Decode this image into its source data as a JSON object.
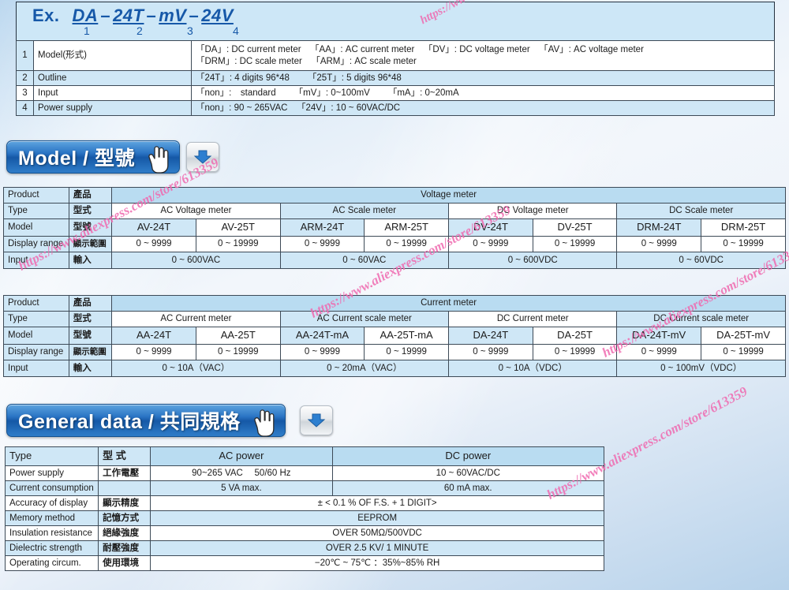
{
  "example": {
    "label": "Ex.",
    "parts": [
      "DA",
      "24T",
      "mV",
      "24V"
    ],
    "separator": "–",
    "numbers": [
      "1",
      "2",
      "3",
      "4"
    ]
  },
  "code_table": {
    "rows": [
      {
        "no": "1",
        "item": "Model(形式)",
        "desc_line1": "「DA」: DC current meter 「AA」: AC current meter 「DV」: DC voltage meter 「AV」: AC voltage meter",
        "desc_line2": "「DRM」: DC scale meter 「ARM」: AC scale meter"
      },
      {
        "no": "2",
        "item": "Outline",
        "desc_line1": "「24T」: 4 digits 96*48  「25T」: 5 digits 96*48",
        "desc_line2": ""
      },
      {
        "no": "3",
        "item": "Input",
        "desc_line1": "「non」: standard  「mV」: 0~100mV  「mA」: 0~20mA",
        "desc_line2": ""
      },
      {
        "no": "4",
        "item": "Power supply",
        "desc_line1": "「non」: 90 ~ 265VAC 「24V」: 10 ~ 60VAC/DC",
        "desc_line2": ""
      }
    ]
  },
  "model_section": {
    "banner_label": "Model / 型號",
    "icons": {
      "hand": "hand-pointer-icon",
      "arrow": "chevron-down-icon"
    },
    "voltage_table": {
      "row_labels": [
        {
          "en": "Product",
          "zh": "產品"
        },
        {
          "en": "Type",
          "zh": "型式"
        },
        {
          "en": "Model",
          "zh": "型號"
        },
        {
          "en": "Display range",
          "zh": "顯示範圍"
        },
        {
          "en": "Input",
          "zh": "輸入"
        }
      ],
      "product": "Voltage meter",
      "types": [
        "AC Voltage meter",
        "AC Scale meter",
        "DC Voltage meter",
        "DC Scale meter"
      ],
      "models": [
        "AV-24T",
        "AV-25T",
        "ARM-24T",
        "ARM-25T",
        "DV-24T",
        "DV-25T",
        "DRM-24T",
        "DRM-25T"
      ],
      "display_ranges": [
        "0 ~ 9999",
        "0 ~ 19999",
        "0 ~ 9999",
        "0 ~ 19999",
        "0 ~ 9999",
        "0 ~ 19999",
        "0 ~ 9999",
        "0 ~ 19999"
      ],
      "inputs": [
        "0 ~ 600VAC",
        "0 ~ 60VAC",
        "0 ~ 600VDC",
        "0 ~ 60VDC"
      ]
    },
    "current_table": {
      "row_labels": [
        {
          "en": "Product",
          "zh": "產品"
        },
        {
          "en": "Type",
          "zh": "型式"
        },
        {
          "en": "Model",
          "zh": "型號"
        },
        {
          "en": "Display range",
          "zh": "顯示範圍"
        },
        {
          "en": "Input",
          "zh": "輸入"
        }
      ],
      "product": "Current meter",
      "types": [
        "AC Current meter",
        "AC Current scale meter",
        "DC Current meter",
        "DC Current scale meter"
      ],
      "models": [
        "AA-24T",
        "AA-25T",
        "AA-24T-mA",
        "AA-25T-mA",
        "DA-24T",
        "DA-25T",
        "DA-24T-mV",
        "DA-25T-mV"
      ],
      "display_ranges": [
        "0 ~ 9999",
        "0 ~ 19999",
        "0 ~ 9999",
        "0 ~ 19999",
        "0 ~ 9999",
        "0 ~ 19999",
        "0 ~ 9999",
        "0 ~ 19999"
      ],
      "inputs": [
        "0 ~ 10A（VAC）",
        "0 ~ 20mA（VAC）",
        "0 ~ 10A（VDC）",
        "0 ~ 100mV（VDC）"
      ]
    }
  },
  "general_section": {
    "banner_label": "General data / 共同規格",
    "icons": {
      "hand": "hand-pointer-icon",
      "arrow": "chevron-down-icon"
    },
    "table": {
      "header": {
        "en": "Type",
        "zh": "型 式",
        "ac": "AC power",
        "dc": "DC power"
      },
      "rows": [
        {
          "en": "Power supply",
          "zh": "工作電壓",
          "ac": "90~265 VAC  50/60 Hz",
          "dc": "10 ~ 60VAC/DC",
          "span": false
        },
        {
          "en": "Current consumption",
          "zh": "",
          "ac": "5 VA max.",
          "dc": "60 mA max.",
          "span": false
        },
        {
          "en": "Accuracy of display",
          "zh": "顯示精度",
          "value": "± < 0.1 % OF F.S. + 1 DIGIT>",
          "span": true
        },
        {
          "en": "Memory method",
          "zh": "記憶方式",
          "value": "EEPROM",
          "span": true
        },
        {
          "en": "Insulation resistance",
          "zh": "絕緣強度",
          "value": "OVER 50MΩ/500VDC",
          "span": true
        },
        {
          "en": "Dielectric strength",
          "zh": "耐壓強度",
          "value": "OVER 2.5 KV/ 1 MINUTE",
          "span": true
        },
        {
          "en": "Operating circum.",
          "zh": "使用環境",
          "value": "−20℃ ~ 75℃ ：35%~85% RH",
          "span": true
        }
      ]
    }
  },
  "watermarks": [
    "https://www.aliexpress.com/store/613359",
    "https://www.aliexpress.com/store/613359",
    "https://www.aliexpress.com/store/613359",
    "https://www.aliexpress.com/store/613359",
    "https://www.aliexpress.com/store/613359"
  ],
  "colors": {
    "accent_blue": "#1658a8",
    "table_blue": "#cfe7f6",
    "header_blue": "#b9dcf1",
    "border": "#3d4a57",
    "watermark": "#f06ab0"
  }
}
